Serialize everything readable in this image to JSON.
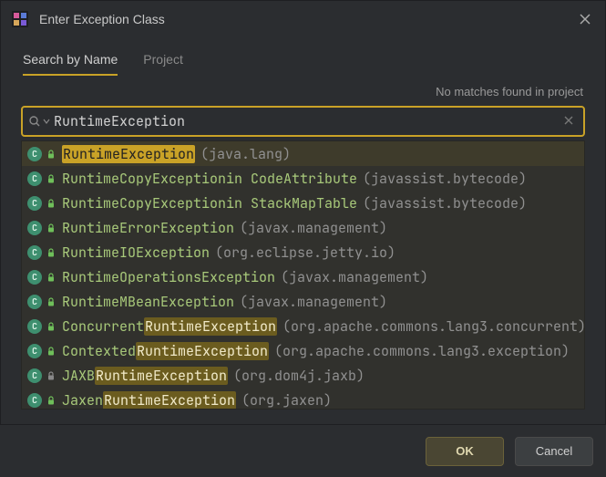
{
  "window": {
    "title": "Enter Exception Class"
  },
  "tabs": {
    "search": "Search by Name",
    "project": "Project"
  },
  "status": "No matches found in project",
  "search": {
    "value": "RuntimeException"
  },
  "results": [
    {
      "icon": "class",
      "lock": "green",
      "name": "RuntimeException",
      "context": "",
      "pkg": "java.lang",
      "selected": true
    },
    {
      "icon": "class",
      "lock": "green",
      "name": "RuntimeCopyException",
      "context": " in CodeAttribute",
      "pkg": "javassist.bytecode"
    },
    {
      "icon": "class",
      "lock": "green",
      "name": "RuntimeCopyException",
      "context": " in StackMapTable",
      "pkg": "javassist.bytecode"
    },
    {
      "icon": "class",
      "lock": "green",
      "name": "RuntimeErrorException",
      "context": "",
      "pkg": "javax.management"
    },
    {
      "icon": "class",
      "lock": "green",
      "name": "RuntimeIOException",
      "context": "",
      "pkg": "org.eclipse.jetty.io"
    },
    {
      "icon": "class",
      "lock": "green",
      "name": "RuntimeOperationsException",
      "context": "",
      "pkg": "javax.management"
    },
    {
      "icon": "class",
      "lock": "green",
      "name": "RuntimeMBeanException",
      "context": "",
      "pkg": "javax.management"
    },
    {
      "icon": "class",
      "lock": "green",
      "name": "ConcurrentRuntimeException",
      "context": "",
      "pkg": "org.apache.commons.lang3.concurrent"
    },
    {
      "icon": "class",
      "lock": "green",
      "name": "ContextedRuntimeException",
      "context": "",
      "pkg": "org.apache.commons.lang3.exception"
    },
    {
      "icon": "class",
      "lock": "gray",
      "name": "JAXBRuntimeException",
      "context": "",
      "pkg": "org.dom4j.jaxb"
    },
    {
      "icon": "class",
      "lock": "green",
      "name": "JaxenRuntimeException",
      "context": "",
      "pkg": "org.jaxen"
    }
  ],
  "highlight_query": "RuntimeException",
  "buttons": {
    "ok": "OK",
    "cancel": "Cancel"
  }
}
